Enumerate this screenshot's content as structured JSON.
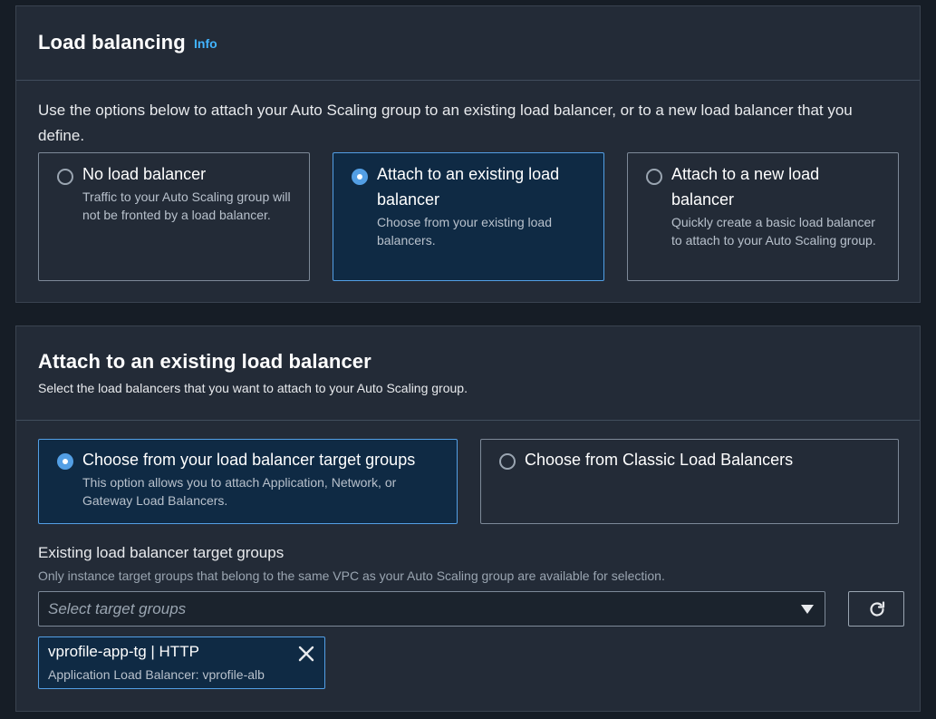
{
  "load_balancing": {
    "title": "Load balancing",
    "info_link": "Info",
    "intro": "Use the options below to attach your Auto Scaling group to an existing load balancer, or to a new load balancer that you define.",
    "options": [
      {
        "title": "No load balancer",
        "description": "Traffic to your Auto Scaling group will not be fronted by a load balancer.",
        "selected": false
      },
      {
        "title": "Attach to an existing load balancer",
        "description": "Choose from your existing load balancers.",
        "selected": true
      },
      {
        "title": "Attach to a new load balancer",
        "description": "Quickly create a basic load balancer to attach to your Auto Scaling group.",
        "selected": false
      }
    ]
  },
  "attach_existing": {
    "title": "Attach to an existing load balancer",
    "description": "Select the load balancers that you want to attach to your Auto Scaling group.",
    "options": [
      {
        "title": "Choose from your load balancer target groups",
        "description": "This option allows you to attach Application, Network, or Gateway Load Balancers.",
        "selected": true
      },
      {
        "title": "Choose from Classic Load Balancers",
        "description": "",
        "selected": false
      }
    ],
    "target_groups": {
      "label": "Existing load balancer target groups",
      "description": "Only instance target groups that belong to the same VPC as your Auto Scaling group are available for selection.",
      "placeholder": "Select target groups",
      "selected_token": {
        "title": "vprofile-app-tg | HTTP",
        "description": "Application Load Balancer: vprofile-alb"
      }
    }
  },
  "colors": {
    "accent": "#539fe5",
    "link": "#42b4ff",
    "panel_bg": "#232b37",
    "selected_bg": "#0f2a44"
  },
  "icons": {
    "refresh": "refresh-icon",
    "dropdown": "caret-down-icon",
    "remove": "close-icon"
  }
}
